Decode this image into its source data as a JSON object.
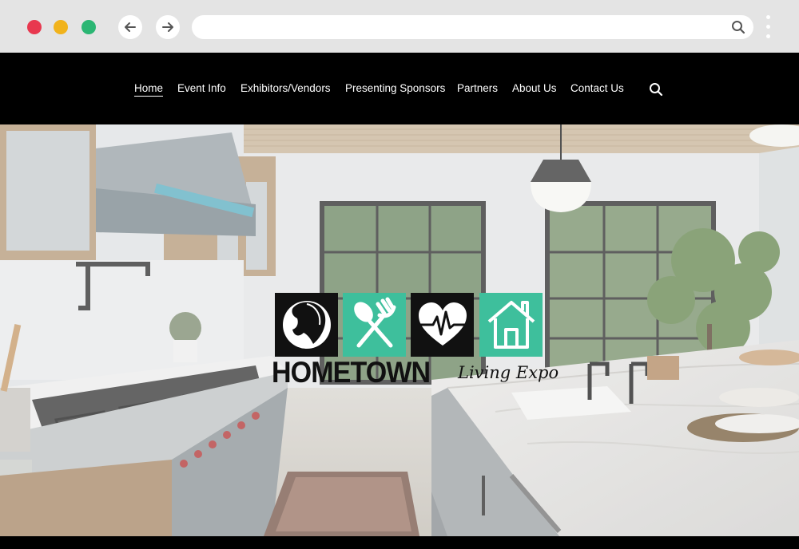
{
  "browser": {
    "back_icon": "arrow-left-icon",
    "forward_icon": "arrow-right-icon",
    "address_bar_icon": "search-icon",
    "menu_icon": "kebab-menu-icon"
  },
  "nav": {
    "items": [
      {
        "label": "Home",
        "active": true
      },
      {
        "label": "Event Info",
        "active": false
      },
      {
        "label": "Exhibitors/Vendors",
        "active": false
      },
      {
        "label": "Presenting Sponsors",
        "active": false
      },
      {
        "label": "Partners",
        "active": false
      },
      {
        "label": "About Us",
        "active": false
      },
      {
        "label": "Contact Us",
        "active": false
      }
    ],
    "search_icon": "search-icon"
  },
  "hero": {
    "image": "kitchen-interior-photo",
    "logo": {
      "word": "HOMETOWN",
      "script": "Living Expo",
      "icons": [
        "woman-face-icon",
        "fork-spoon-icon",
        "heartbeat-icon",
        "house-icon"
      ]
    }
  },
  "colors": {
    "header_bg": "#000000",
    "accent_teal": "#3ebf9c",
    "chrome_bg": "#e4e4e4"
  }
}
